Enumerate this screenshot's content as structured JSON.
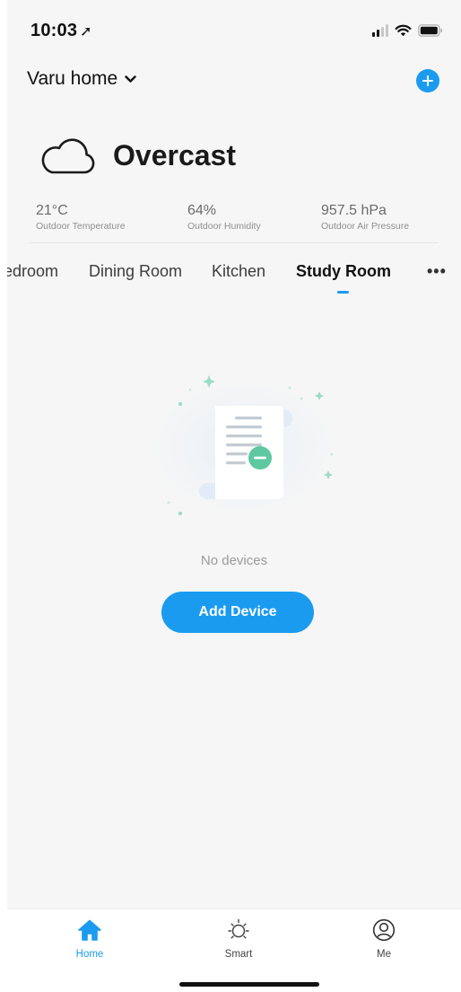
{
  "status_bar": {
    "time": "10:03",
    "location_glyph": "➚"
  },
  "header": {
    "home_name": "Varu home",
    "add_button_icon": "plus-circle-icon"
  },
  "weather": {
    "condition": "Overcast",
    "icon": "cloud-icon",
    "stats": [
      {
        "value": "21°C",
        "label": "Outdoor Temperature"
      },
      {
        "value": "64%",
        "label": "Outdoor Humidity"
      },
      {
        "value": "957.5 hPa",
        "label": "Outdoor Air Pressure"
      }
    ]
  },
  "rooms": {
    "tabs": [
      "edroom",
      "Dining Room",
      "Kitchen",
      "Study Room"
    ],
    "active_index": 3,
    "more_label": "•••"
  },
  "empty_state": {
    "message": "No devices",
    "action_label": "Add Device"
  },
  "tabbar": {
    "items": [
      {
        "label": "Home",
        "icon": "house-icon",
        "active": true
      },
      {
        "label": "Smart",
        "icon": "sun-icon",
        "active": false
      },
      {
        "label": "Me",
        "icon": "user-circle-icon",
        "active": false
      }
    ]
  },
  "colors": {
    "accent": "#1a9bf0",
    "background": "#f6f6f6",
    "text": "#1a1a1a"
  }
}
